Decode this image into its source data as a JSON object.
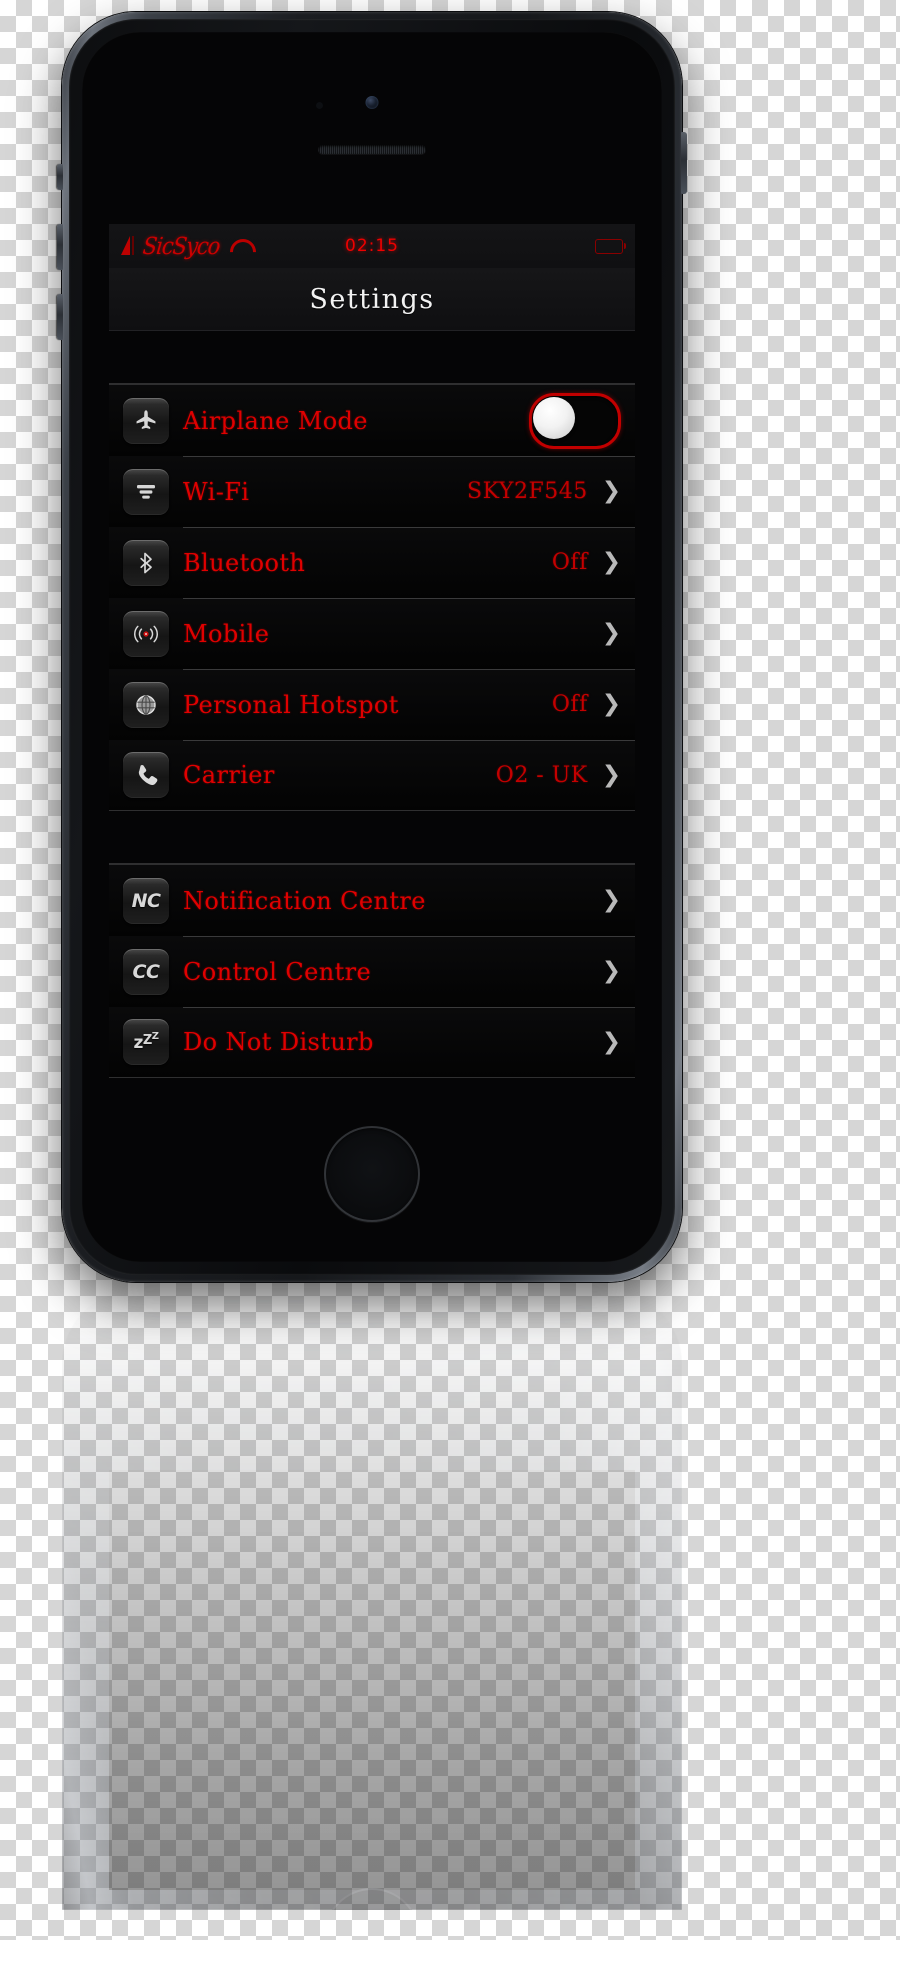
{
  "status_bar": {
    "signal_icon": "signal-bars-icon",
    "carrier_name": "SicSyco",
    "wifi_icon": "wifi-icon",
    "time": "02:15",
    "battery_icon": "battery-icon"
  },
  "nav_bar": {
    "title": "Settings"
  },
  "colors": {
    "accent_red": "#e00000",
    "value_red": "#c40000",
    "title_white": "#f2f2f2",
    "screen_black": "#000000",
    "separator": "#3a3a3b"
  },
  "groups": [
    {
      "rows": [
        {
          "icon": "airplane-icon",
          "label": "Airplane Mode",
          "value": "",
          "control": "toggle",
          "toggle_on": false,
          "chevron": false
        },
        {
          "icon": "wifi-signal-icon",
          "label": "Wi-Fi",
          "value": "SKY2F545",
          "control": "disclosure",
          "chevron": true
        },
        {
          "icon": "bluetooth-icon",
          "label": "Bluetooth",
          "value": "Off",
          "control": "disclosure",
          "chevron": true
        },
        {
          "icon": "cellular-waves-icon",
          "label": "Mobile",
          "value": "",
          "control": "disclosure",
          "chevron": true
        },
        {
          "icon": "hotspot-globe-icon",
          "label": "Personal Hotspot",
          "value": "Off",
          "control": "disclosure",
          "chevron": true
        },
        {
          "icon": "phone-handset-icon",
          "label": "Carrier",
          "value": "O2 - UK",
          "control": "disclosure",
          "chevron": true
        }
      ]
    },
    {
      "rows": [
        {
          "icon": "notification-centre-icon",
          "icon_text": "NC",
          "label": "Notification Centre",
          "value": "",
          "control": "disclosure",
          "chevron": true
        },
        {
          "icon": "control-centre-icon",
          "icon_text": "CC",
          "label": "Control Centre",
          "value": "",
          "control": "disclosure",
          "chevron": true
        },
        {
          "icon": "do-not-disturb-icon",
          "icon_text": "zZZ",
          "label": "Do Not Disturb",
          "value": "",
          "control": "disclosure",
          "chevron": true
        }
      ]
    }
  ],
  "chevron_glyph": "❯"
}
